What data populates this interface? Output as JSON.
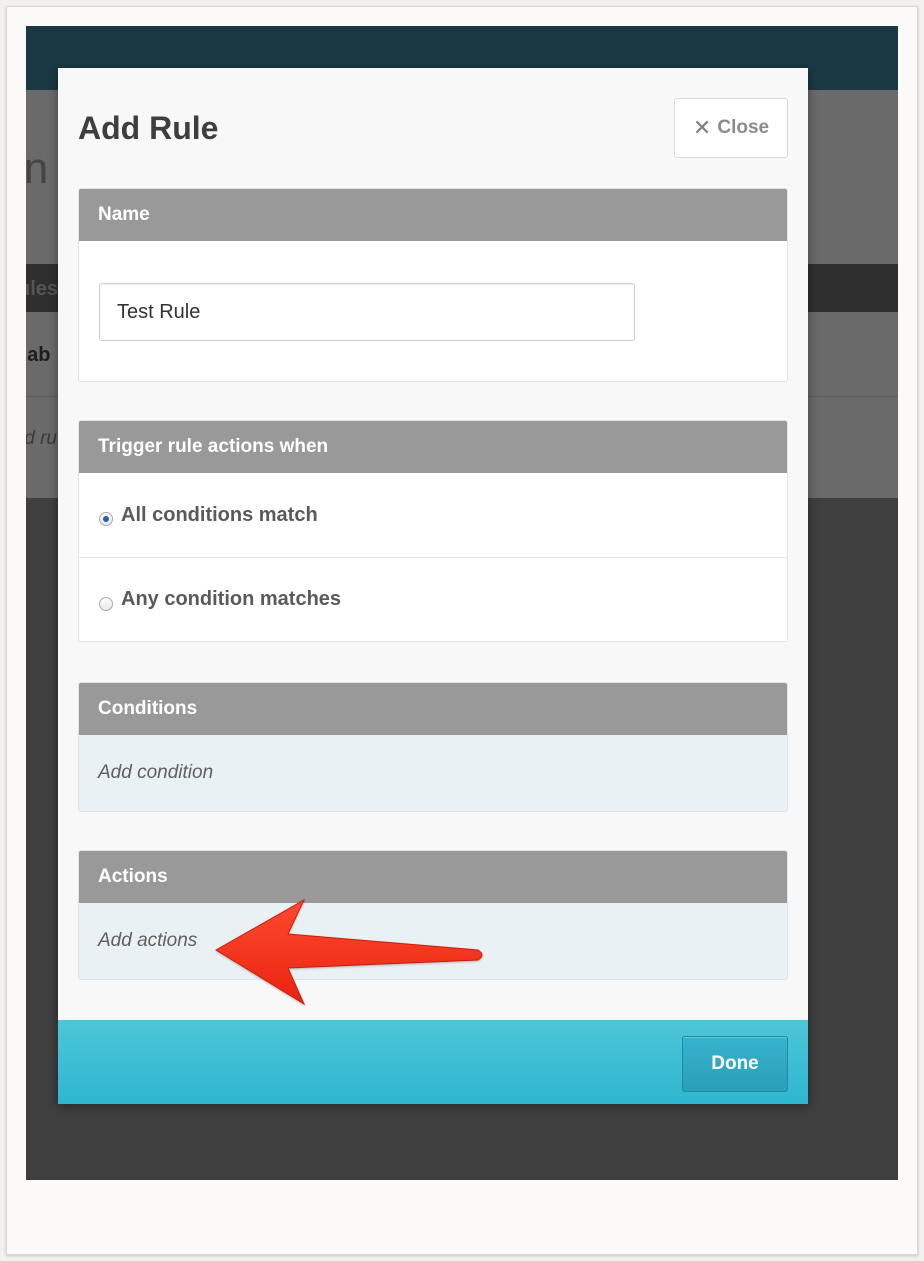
{
  "background": {
    "title_fragment": "in",
    "rules_fragment": "ules",
    "row1_fragment": "l ab",
    "row2_fragment": "ld ru"
  },
  "modal": {
    "title": "Add Rule",
    "close_label": "Close",
    "close_icon": "x-icon",
    "name_panel": {
      "header": "Name",
      "input_value": "Test Rule"
    },
    "trigger_panel": {
      "header": "Trigger rule actions when",
      "options": [
        {
          "label": "All conditions match",
          "checked": true
        },
        {
          "label": "Any condition matches",
          "checked": false
        }
      ]
    },
    "conditions_panel": {
      "header": "Conditions",
      "link": "Add condition"
    },
    "actions_panel": {
      "header": "Actions",
      "link": "Add actions"
    },
    "footer": {
      "done_label": "Done"
    }
  },
  "annotation": {
    "type": "arrow-icon",
    "color": "#f4341e"
  },
  "colors": {
    "panel_header": "#999999",
    "footer_accent": "#2fb6cf",
    "overlay": "#3f3f3f"
  }
}
